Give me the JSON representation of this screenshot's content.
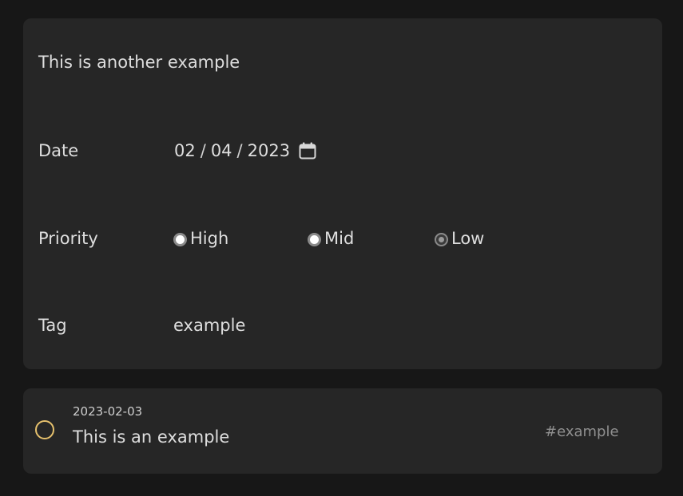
{
  "editor": {
    "title": "This is another example",
    "date": {
      "label": "Date",
      "month": "02",
      "day": "04",
      "year": "2023",
      "separator": "/",
      "icon": "calendar-icon"
    },
    "priority": {
      "label": "Priority",
      "options": [
        {
          "label": "High",
          "selected": false
        },
        {
          "label": "Mid",
          "selected": false
        },
        {
          "label": "Low",
          "selected": true
        }
      ]
    },
    "tag": {
      "label": "Tag",
      "value": "example"
    }
  },
  "todo": {
    "date": "2023-02-03",
    "text": "This is an example",
    "tag": "#example",
    "checkbox_color": "#e6c16d"
  }
}
